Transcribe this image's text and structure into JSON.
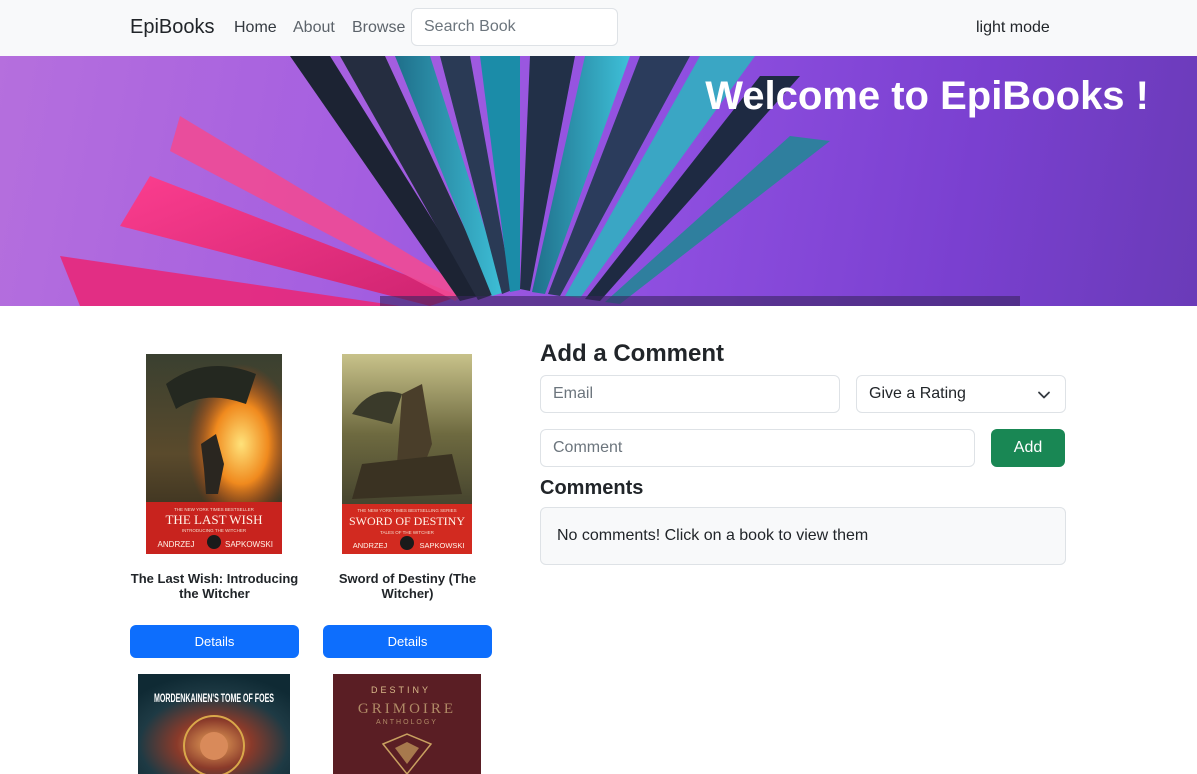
{
  "navbar": {
    "brand": "EpiBooks",
    "links": [
      "Home",
      "About",
      "Browse"
    ],
    "search_placeholder": "Search Book",
    "mode_toggle": "light mode"
  },
  "hero": {
    "title": "Welcome to EpiBooks !"
  },
  "books": [
    {
      "title": "The Last Wish: Introducing the Witcher",
      "button": "Details",
      "cover": {
        "banner_top": "THE NEW YORK TIMES BESTSELLER",
        "name": "THE LAST WISH",
        "subtitle": "INTRODUCING THE WITCHER",
        "author_first": "ANDRZEJ",
        "author_last": "SAPKOWSKI"
      }
    },
    {
      "title": "Sword of Destiny (The Witcher)",
      "button": "Details",
      "cover": {
        "banner_top": "THE NEW YORK TIMES BESTSELLING SERIES",
        "name": "SWORD OF DESTINY",
        "subtitle": "TALES OF THE WITCHER",
        "author_first": "ANDRZEJ",
        "author_last": "SAPKOWSKI"
      }
    },
    {
      "title": "",
      "cover": {
        "name": "MORDENKAINEN'S TOME OF FOES"
      }
    },
    {
      "title": "",
      "cover": {
        "top": "DESTINY",
        "name": "GRIMOIRE",
        "sub": "ANTHOLOGY"
      }
    }
  ],
  "comment_form": {
    "heading": "Add a Comment",
    "email_placeholder": "Email",
    "rating_label": "Give a Rating",
    "comment_placeholder": "Comment",
    "add_button": "Add"
  },
  "comments": {
    "heading": "Comments",
    "empty_message": "No comments! Click on a book to view them"
  },
  "colors": {
    "primary": "#0d6efd",
    "success": "#198754",
    "navbar_bg": "#f8f9fa"
  }
}
